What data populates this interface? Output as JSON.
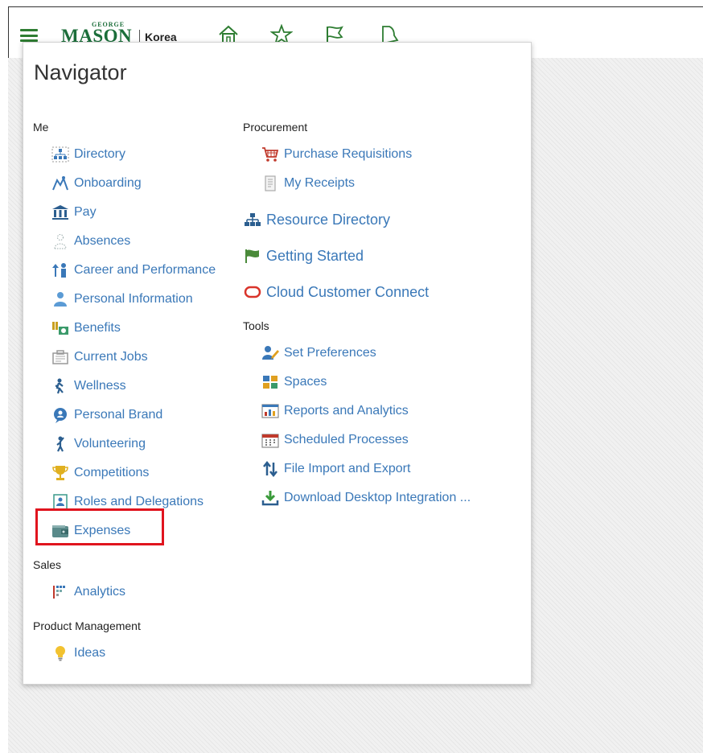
{
  "header": {
    "logo_top": "GEORGE",
    "logo_main": "MASON",
    "logo_sub": "Korea",
    "icons": [
      "menu-icon",
      "home-icon",
      "star-icon",
      "flag-icon",
      "bell-icon"
    ]
  },
  "navigator": {
    "title": "Navigator",
    "me": {
      "heading": "Me",
      "items": [
        {
          "label": "Directory",
          "icon": "directory-icon"
        },
        {
          "label": "Onboarding",
          "icon": "onboarding-icon"
        },
        {
          "label": "Pay",
          "icon": "bank-icon"
        },
        {
          "label": "Absences",
          "icon": "absences-icon"
        },
        {
          "label": "Career and Performance",
          "icon": "career-icon"
        },
        {
          "label": "Personal Information",
          "icon": "person-icon"
        },
        {
          "label": "Benefits",
          "icon": "benefits-icon"
        },
        {
          "label": "Current Jobs",
          "icon": "jobs-icon"
        },
        {
          "label": "Wellness",
          "icon": "wellness-icon"
        },
        {
          "label": "Personal Brand",
          "icon": "brand-icon"
        },
        {
          "label": "Volunteering",
          "icon": "volunteer-icon"
        },
        {
          "label": "Competitions",
          "icon": "trophy-icon"
        },
        {
          "label": "Roles and Delegations",
          "icon": "roles-icon"
        },
        {
          "label": "Expenses",
          "icon": "wallet-icon"
        }
      ]
    },
    "sales": {
      "heading": "Sales",
      "items": [
        {
          "label": "Analytics",
          "icon": "analytics-icon"
        }
      ]
    },
    "product_management": {
      "heading": "Product Management",
      "items": [
        {
          "label": "Ideas",
          "icon": "lightbulb-icon"
        }
      ]
    },
    "procurement": {
      "heading": "Procurement",
      "items": [
        {
          "label": "Purchase Requisitions",
          "icon": "cart-icon"
        },
        {
          "label": "My Receipts",
          "icon": "receipt-icon"
        }
      ]
    },
    "standalone": [
      {
        "label": "Resource Directory",
        "icon": "org-chart-icon"
      },
      {
        "label": "Getting Started",
        "icon": "flag-icon"
      },
      {
        "label": "Cloud Customer Connect",
        "icon": "connect-icon"
      }
    ],
    "tools": {
      "heading": "Tools",
      "items": [
        {
          "label": "Set Preferences",
          "icon": "preferences-icon"
        },
        {
          "label": "Spaces",
          "icon": "spaces-icon"
        },
        {
          "label": "Reports and Analytics",
          "icon": "reports-icon"
        },
        {
          "label": "Scheduled Processes",
          "icon": "calendar-icon"
        },
        {
          "label": "File Import and Export",
          "icon": "import-export-icon"
        },
        {
          "label": "Download Desktop Integration ...",
          "icon": "download-icon"
        }
      ]
    }
  },
  "colors": {
    "link": "#3a78b8",
    "brand": "#1b6e3a",
    "highlight": "#e0141e"
  }
}
